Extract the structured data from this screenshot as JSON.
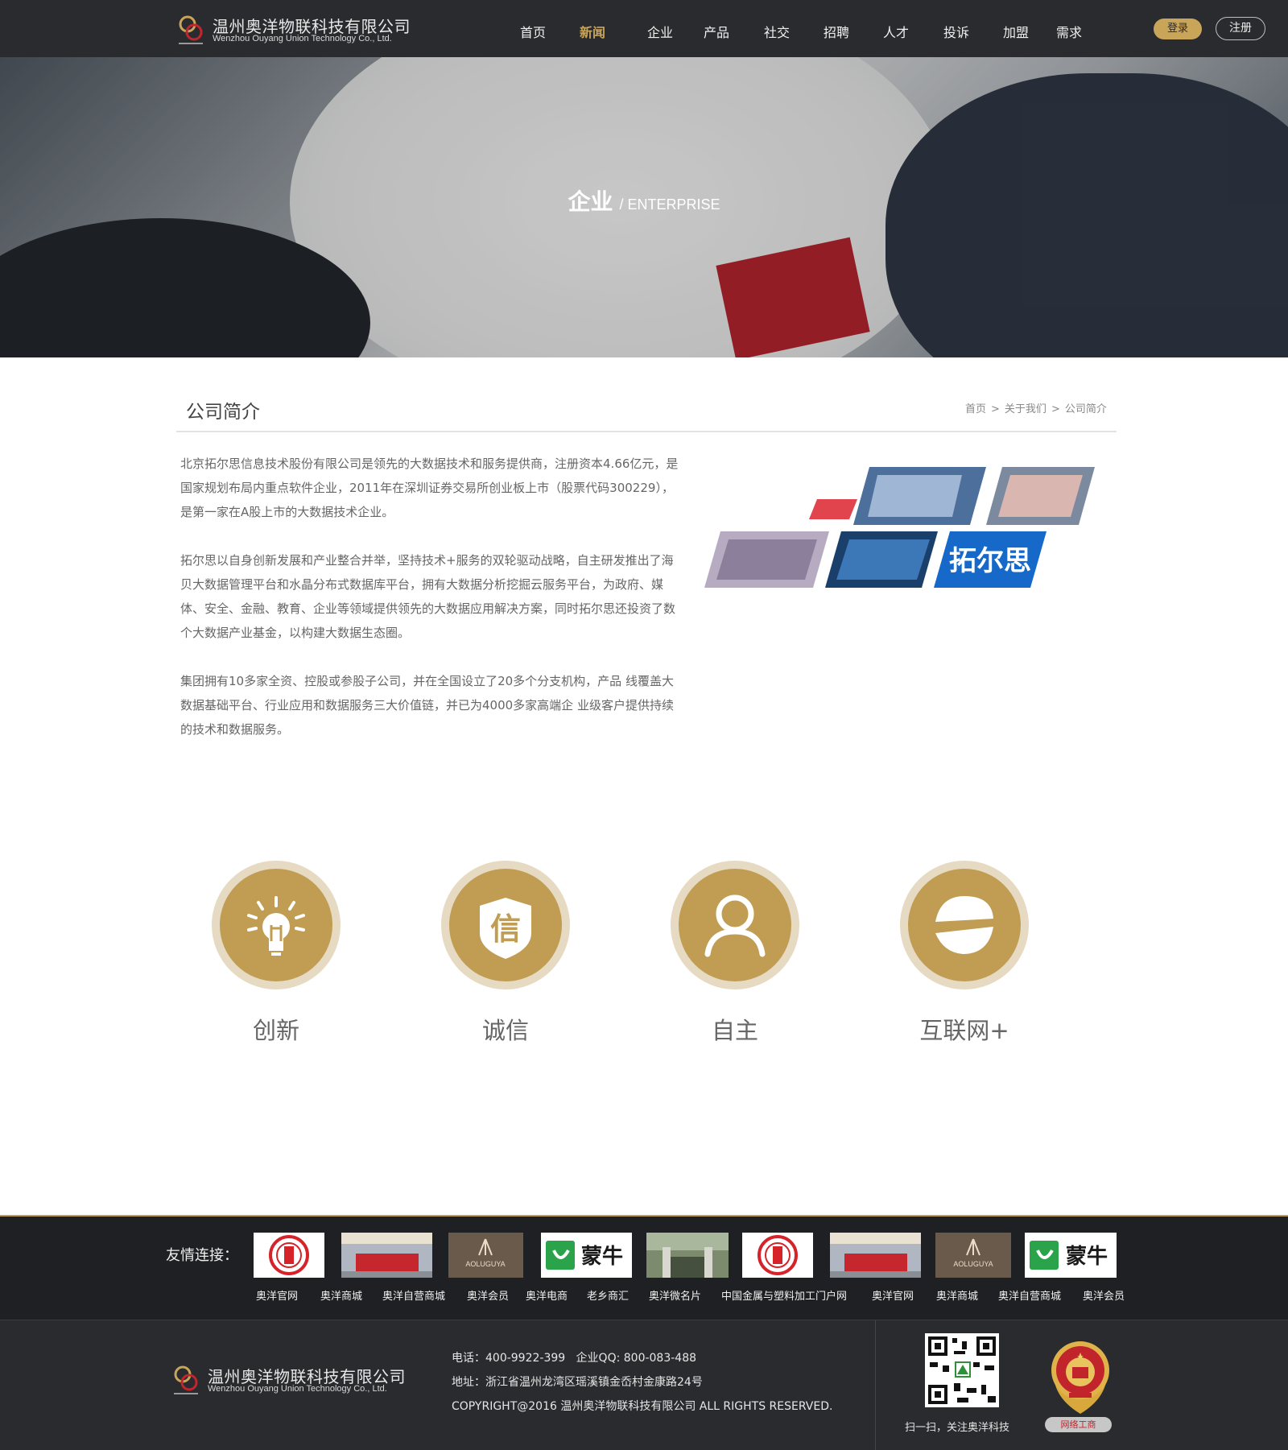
{
  "header": {
    "company_cn": "温州奥洋物联科技有限公司",
    "company_en": "Wenzhou Ouyang Union Technology Co., Ltd.",
    "nav": [
      "首页",
      "新闻",
      "企业",
      "产品",
      "社交",
      "招聘",
      "人才",
      "投诉",
      "加盟",
      "需求"
    ],
    "active_nav": "新闻",
    "login": "登录",
    "register": "注册"
  },
  "banner": {
    "title_cn": "企业",
    "title_en": "/ ENTERPRISE"
  },
  "section": {
    "title": "公司简介",
    "breadcrumb": [
      "首页",
      ">",
      "关于我们",
      ">",
      "公司简介"
    ]
  },
  "intro": {
    "paragraphs": [
      "北京拓尔思信息技术股份有限公司是领先的大数据技术和服务提供商，注册资本4.66亿元，是国家规划布局内重点软件企业，2011年在深圳证券交易所创业板上市（股票代码300229），是第一家在A股上市的大数据技术企业。",
      "拓尔思以自身创新发展和产业整合并举，坚持技术+服务的双轮驱动战略，自主研发推出了海贝大数据管理平台和水晶分布式数据库平台，拥有大数据分析挖掘云服务平台，为政府、媒体、安全、金融、教育、企业等领域提供领先的大数据应用解决方案，同时拓尔思还投资了数个大数据产业基金，以构建大数据生态圈。",
      "集团拥有10多家全资、控股或参股子公司，并在全国设立了20多个分支机构，产品 线覆盖大数据基础平台、行业应用和数据服务三大价值链，并已为4000多家高端企 业级客户提供持续的技术和数据服务。"
    ],
    "image_brand": "拓尔思"
  },
  "values": [
    {
      "label": "创新",
      "icon": "lightbulb-icon"
    },
    {
      "label": "诚信",
      "icon": "shield-xin-icon",
      "icon_char": "信"
    },
    {
      "label": "自主",
      "icon": "person-icon"
    },
    {
      "label": "互联网+",
      "icon": "planet-icon"
    }
  ],
  "friend_links": {
    "label": "友情连接：",
    "logos": [
      {
        "type": "seal"
      },
      {
        "type": "store"
      },
      {
        "type": "brand",
        "text": "AOLUGUYA"
      },
      {
        "type": "mengniu",
        "text": "蒙牛"
      },
      {
        "type": "gate"
      },
      {
        "type": "seal"
      },
      {
        "type": "store"
      },
      {
        "type": "brand",
        "text": "AOLUGUYA"
      },
      {
        "type": "mengniu",
        "text": "蒙牛"
      }
    ],
    "names": [
      "奥洋官网",
      "奥洋商城",
      "奥洋自营商城",
      "奥洋会员",
      "奥洋电商",
      "老乡商汇",
      "奥洋微名片",
      "中国金属与塑料加工门户网",
      "奥洋官网",
      "奥洋商城",
      "奥洋自营商城",
      "奥洋会员"
    ]
  },
  "footer": {
    "phone": "电话：400-9922-399",
    "qq": "企业QQ: 800-083-488",
    "address": "地址：浙江省温州龙湾区瑶溪镇金岙村金康路24号",
    "copyright": "COPYRIGHT@2016 温州奥洋物联科技有限公司 ALL RIGHTS RESERVED.",
    "qr_caption": "扫一扫，关注奥洋科技",
    "badge_label": "网络工商"
  },
  "colors": {
    "header_bg": "#2a2b2f",
    "gold": "#c19d53",
    "ring": "#e6dac3",
    "footer_bg": "#1f2023"
  }
}
